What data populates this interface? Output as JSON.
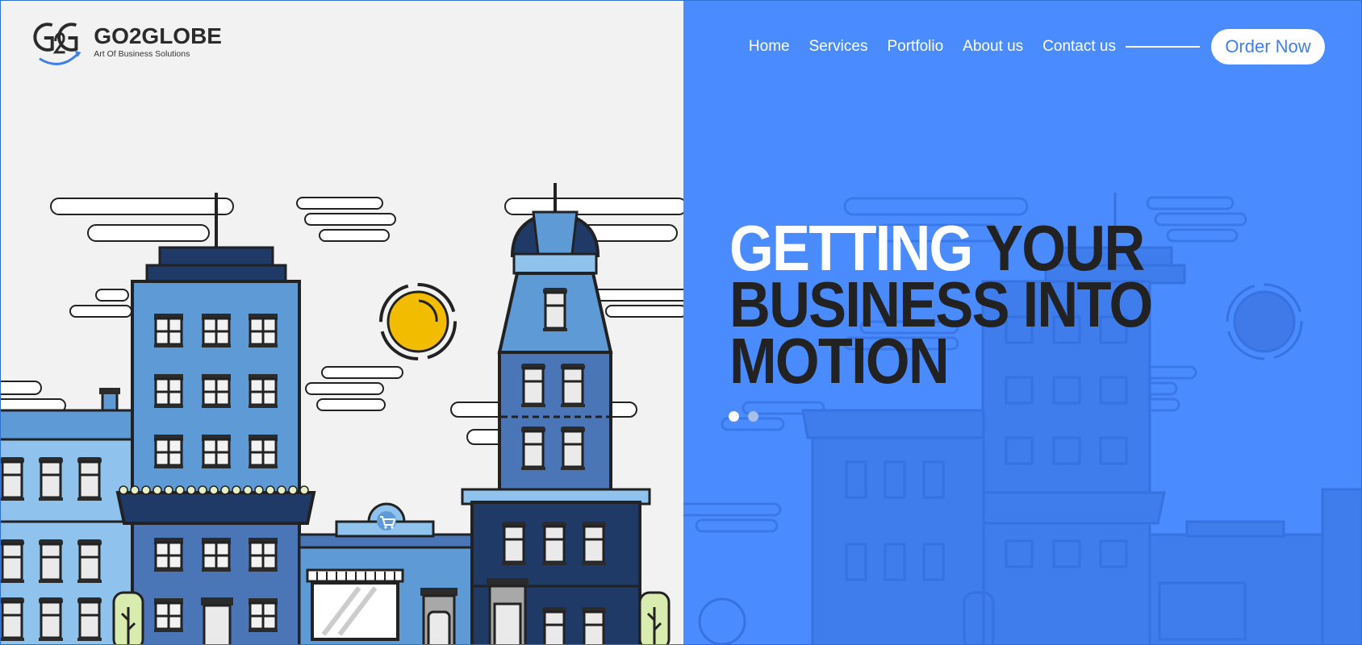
{
  "brand": {
    "name": "GO2GLOBE",
    "tagline": "Art Of Business Solutions",
    "mark_text": "G2G"
  },
  "nav": {
    "items": [
      {
        "label": "Home"
      },
      {
        "label": "Services"
      },
      {
        "label": "Portfolio"
      },
      {
        "label": "About us"
      },
      {
        "label": "Contact us"
      }
    ],
    "cta_label": "Order Now"
  },
  "hero": {
    "line1_highlight": "GETTING",
    "line1_rest": " YOUR",
    "line2": "BUSINESS INTO",
    "line3": "MOTION"
  },
  "slider": {
    "slide_count": 2,
    "active_slide": 1
  },
  "colors": {
    "accent_blue": "#4a8cff",
    "background": "#f2f2f2",
    "building_light": "#8fc3ee",
    "building_mid": "#5e9ad6",
    "building_dark": "#1f3a66",
    "sun": "#f2bd00",
    "headline_dark": "#222222",
    "button_text": "#3f7fe8"
  },
  "icons": {
    "cart": "shopping-cart-icon",
    "sun": "sun-icon"
  }
}
